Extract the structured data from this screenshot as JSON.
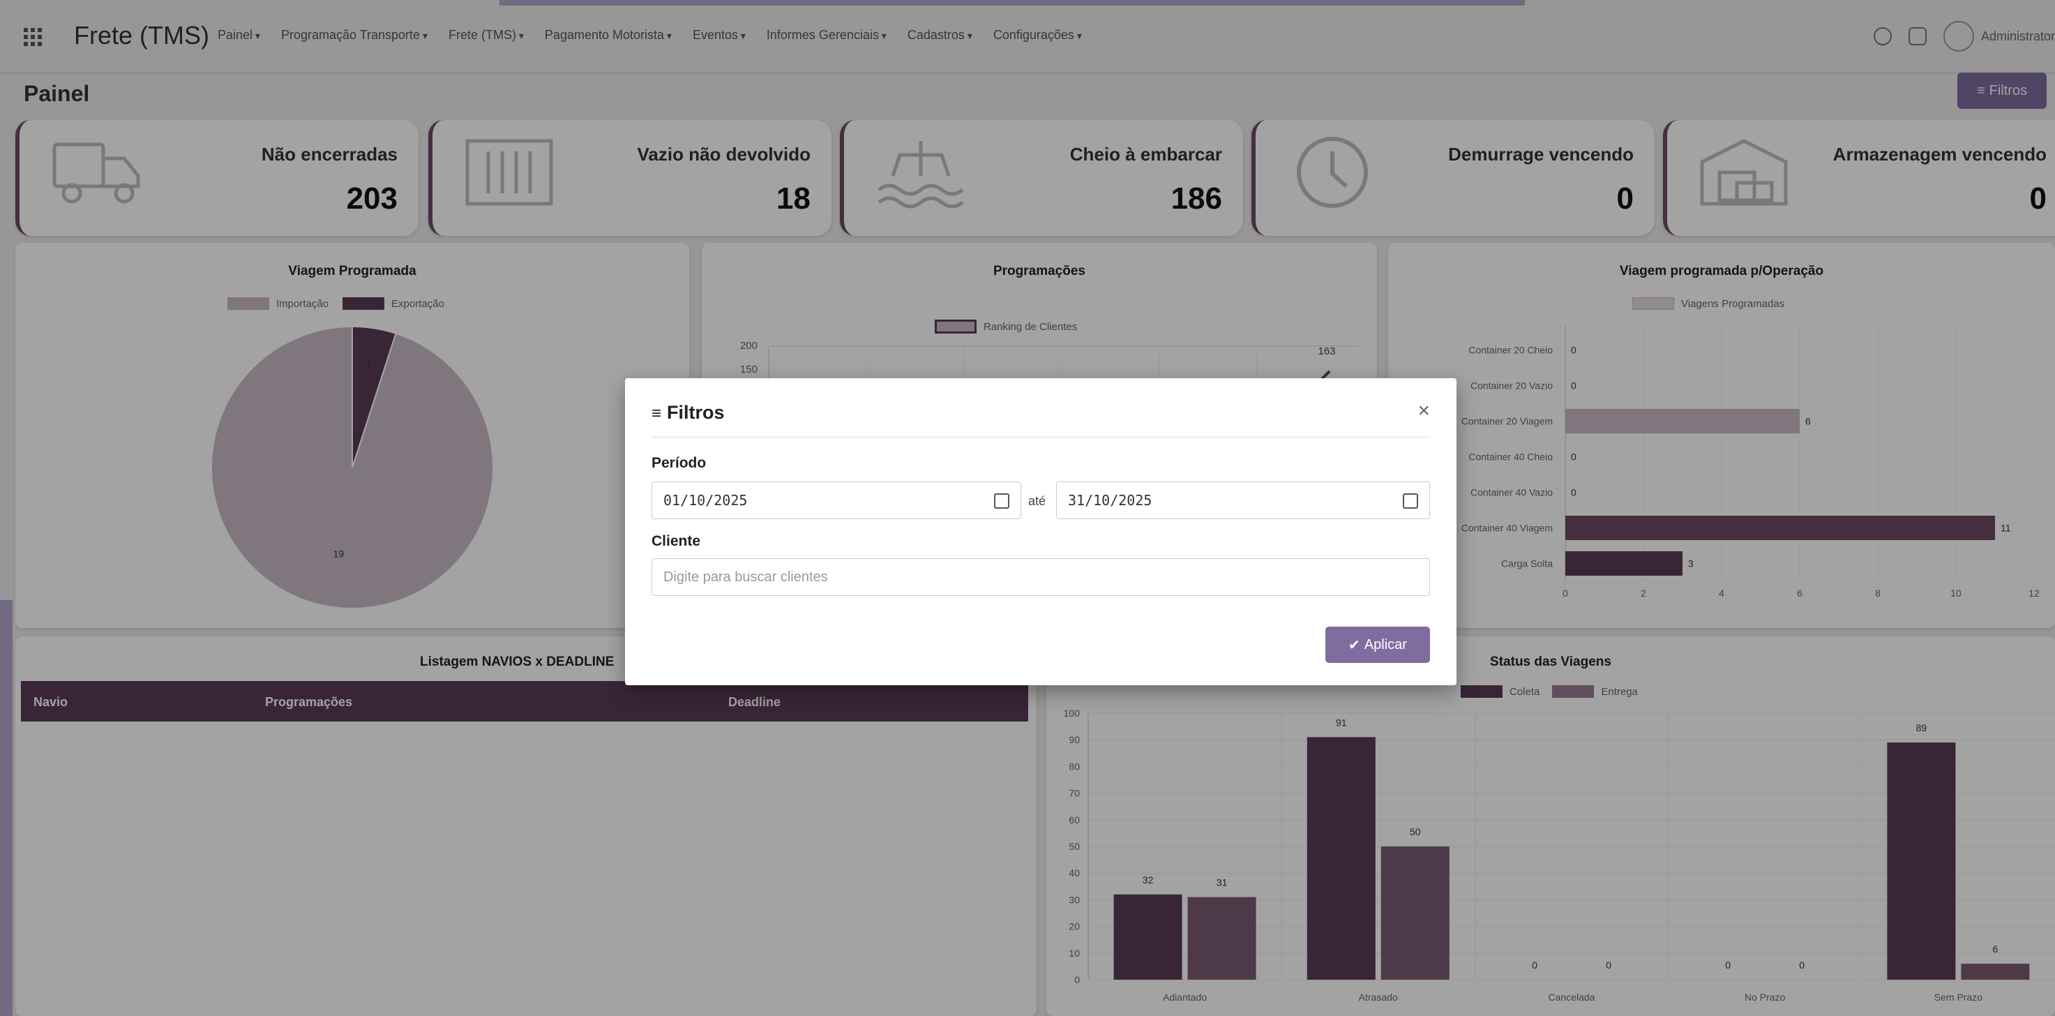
{
  "app": {
    "brand": "Frete (TMS)",
    "menu": [
      "Painel",
      "Programação Transporte",
      "Frete (TMS)",
      "Pagamento Motorista",
      "Eventos",
      "Informes Gerenciais",
      "Cadastros",
      "Configurações"
    ],
    "user": "Administrator"
  },
  "page": {
    "title": "Painel",
    "filter_button": "Filtros"
  },
  "kpis": [
    {
      "label": "Não encerradas",
      "value": "203",
      "icon": "truck-icon"
    },
    {
      "label": "Vazio não devolvido",
      "value": "18",
      "icon": "container-icon"
    },
    {
      "label": "Cheio à embarcar",
      "value": "186",
      "icon": "ship-icon"
    },
    {
      "label": "Demurrage vencendo",
      "value": "0",
      "icon": "clock-icon"
    },
    {
      "label": "Armazenagem vencendo",
      "value": "0",
      "icon": "warehouse-icon"
    }
  ],
  "colors": {
    "dark": "#5c3a57",
    "mid": "#7b5a73",
    "light": "#c9b9c6",
    "accent": "#7f6d9f"
  },
  "table": {
    "title": "Listagem NAVIOS x DEADLINE",
    "columns": [
      "Navio",
      "Programações",
      "Deadline"
    ]
  },
  "modal": {
    "title": "Filtros",
    "period_label": "Período",
    "date_from": "01/10/2025",
    "date_sep": "até",
    "date_to": "31/10/2025",
    "client_label": "Cliente",
    "client_placeholder": "Digite para buscar clientes",
    "apply_label": "Aplicar"
  },
  "chart_data": [
    {
      "type": "pie",
      "title": "Viagem Programada",
      "categories": [
        "Importação",
        "Exportação"
      ],
      "values": [
        19,
        1
      ]
    },
    {
      "type": "line",
      "title": "Programações",
      "series": [
        {
          "name": "Ranking de Clientes",
          "values": [
            163
          ]
        }
      ],
      "yticks": [
        "200",
        "150"
      ],
      "ylim": [
        0,
        200
      ]
    },
    {
      "type": "bar",
      "orientation": "horizontal",
      "title": "Viagem programada p/Operação",
      "categories": [
        "Container 20 Cheio",
        "Container 20 Vazio",
        "Container 20 Viagem",
        "Container 40 Cheio",
        "Container 40 Vazio",
        "Container 40 Viagem",
        "Carga Solta"
      ],
      "series": [
        {
          "name": "Viagens Programadas",
          "values": [
            0,
            0,
            6,
            0,
            0,
            11,
            3
          ]
        }
      ],
      "xlim": [
        0,
        12
      ],
      "xticks": [
        0,
        2,
        4,
        6,
        8,
        10,
        12
      ]
    },
    {
      "type": "bar",
      "title": "Status das Viagens",
      "categories": [
        "Adiantado",
        "Atrasado",
        "Cancelada",
        "No Prazo",
        "Sem Prazo"
      ],
      "series": [
        {
          "name": "Coleta",
          "values": [
            32,
            91,
            0,
            0,
            89
          ]
        },
        {
          "name": "Entrega",
          "values": [
            31,
            50,
            0,
            0,
            6
          ]
        }
      ],
      "ylim": [
        0,
        100
      ],
      "yticks": [
        0,
        10,
        20,
        30,
        40,
        50,
        60,
        70,
        80,
        90,
        100
      ]
    }
  ]
}
